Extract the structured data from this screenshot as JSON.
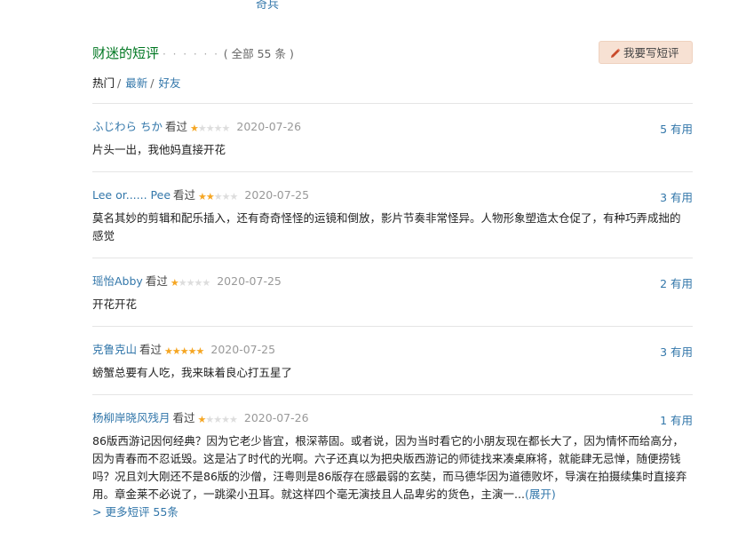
{
  "top_link": "奇兵",
  "section": {
    "title": "财迷的短评",
    "dots": "· · · · · ·",
    "count": "( 全部 55 条 )",
    "write_button": "我要写短评"
  },
  "tabs": [
    {
      "label": "热门"
    },
    {
      "label": "最新"
    },
    {
      "label": "好友"
    }
  ],
  "tab_separator": "/",
  "comments": [
    {
      "user": "ふじわら ちか",
      "action": "看过",
      "rating": 1,
      "date": "2020-07-26",
      "votes": "5 有用",
      "text": "片头一出，我他妈直接开花"
    },
    {
      "user": "Lee or...... Pee",
      "action": "看过",
      "rating": 2,
      "date": "2020-07-25",
      "votes": "3 有用",
      "text": "莫名其妙的剪辑和配乐插入，还有奇奇怪怪的运镜和倒放，影片节奏非常怪异。人物形象塑造太仓促了，有种巧弄成拙的感觉"
    },
    {
      "user": "瑶怡Abby",
      "action": "看过",
      "rating": 1,
      "date": "2020-07-25",
      "votes": "2 有用",
      "text": "开花开花"
    },
    {
      "user": "克鲁克山",
      "action": "看过",
      "rating": 5,
      "date": "2020-07-25",
      "votes": "3 有用",
      "text": "螃蟹总要有人吃，我来昧着良心打五星了"
    },
    {
      "user": "杨柳岸晓风残月",
      "action": "看过",
      "rating": 1,
      "date": "2020-07-26",
      "votes": "1 有用",
      "text": "86版西游记因何经典？因为它老少皆宜，根深蒂固。或者说，因为当时看它的小朋友现在都长大了，因为情怀而给高分，因为青春而不忍诋毁。这是沾了时代的光啊。六子还真以为把央版西游记的师徒找来凑桌麻将，就能肆无忌惮，随便捞钱吗？况且刘大刚还不是86版的沙僧，汪粤则是86版存在感最弱的玄奘，而马德华因为道德败坏，导演在拍摄续集时直接弃用。章金莱不必说了，一跳梁小丑耳。就这样四个毫无演技且人品卑劣的货色，主演一...",
      "expand": "(展开)"
    }
  ],
  "more_link": "> 更多短评  55条",
  "colors": {
    "link": "#3377aa",
    "title_green": "#007722",
    "star": "#f5a623",
    "button_bg": "#f7e1d3",
    "pencil": "#c94a2a"
  }
}
